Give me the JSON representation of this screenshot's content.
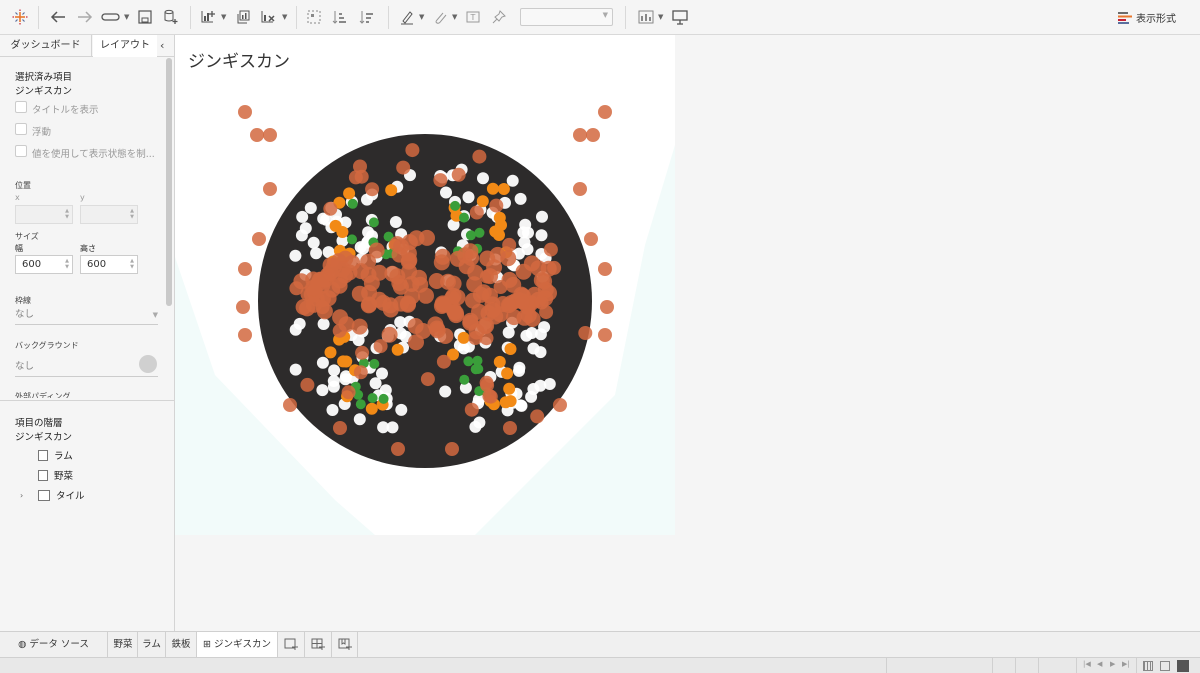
{
  "toolbar": {
    "format_label": "表示形式",
    "icons": [
      "tableau-logo-icon",
      "undo-icon",
      "redo-icon",
      "replay-icon",
      "save-icon",
      "new-datasource-icon",
      "new-worksheet-icon",
      "duplicate-icon",
      "clear-icon",
      "group-icon",
      "sort-asc-icon",
      "sort-desc-icon",
      "highlight-icon",
      "annotate-icon",
      "label-icon",
      "pin-icon",
      "fit-dropdown",
      "show-me-icon",
      "presentation-icon"
    ]
  },
  "left_panel": {
    "tabs": [
      "ダッシュボード",
      "レイアウト"
    ],
    "selected_section_title": "選択済み項目",
    "selected_item_name": "ジンギスカン",
    "checkboxes": [
      "タイトルを表示",
      "浮動",
      "値を使用して表示状態を制..."
    ],
    "position_title": "位置",
    "x_label": "x",
    "y_label": "y",
    "size_title": "サイズ",
    "width_label": "幅",
    "height_label": "高さ",
    "width_value": "600",
    "height_value": "600",
    "border_title": "枠線",
    "border_value": "なし",
    "background_title": "バックグラウンド",
    "background_value": "なし",
    "outer_padding_title": "外部パディング",
    "hierarchy_title": "項目の階層",
    "hierarchy_root": "ジンギスカン",
    "hierarchy_items": [
      "ラム",
      "野菜",
      "タイル"
    ]
  },
  "dashboard": {
    "title": "ジンギスカン"
  },
  "sheet_tabs": {
    "datasource": "データ ソース",
    "sheets": [
      "野菜",
      "ラム",
      "鉄板",
      "ジンギスカン"
    ],
    "active": "ジンギスカン"
  },
  "colors": {
    "plate": "#2d2b2b",
    "lamb": "#d2693f",
    "carrot": "#f28a16",
    "pepper": "#3a9e3a",
    "onion": "#ffffff",
    "background_tint": "#f2fbfa"
  }
}
